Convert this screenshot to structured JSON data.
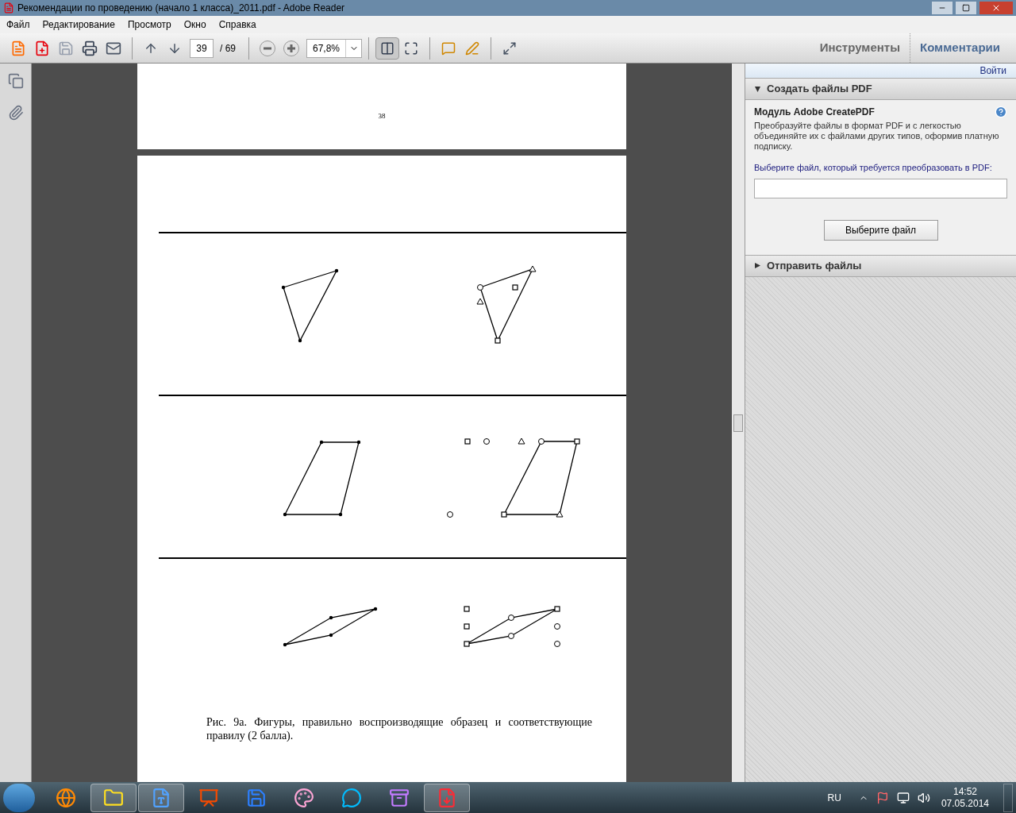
{
  "window": {
    "title": "Рекомендации по проведению (начало 1 класса)_2011.pdf - Adobe Reader"
  },
  "menu": [
    "Файл",
    "Редактирование",
    "Просмотр",
    "Окно",
    "Справка"
  ],
  "toolbar": {
    "page": "39",
    "total": "/ 69",
    "zoom": "67,8%"
  },
  "right_tabs": [
    {
      "label": "Инструменты",
      "selected": false
    },
    {
      "label": "Комментарии",
      "selected": true
    }
  ],
  "document": {
    "page_number": "38",
    "caption": "Рис. 9а. Фигуры, правильно воспроизводящие образец и соответствующие правилу (2 балла)."
  },
  "panel": {
    "login": "Войти",
    "sections": [
      {
        "title": "Создать файлы PDF",
        "expanded": true,
        "heading": "Модуль Adobe CreatePDF",
        "text": "Преобразуйте файлы в формат PDF и с легкостью объединяйте их с файлами других типов, оформив платную подписку.",
        "field_label": "Выберите файл, который требуется преобразовать в PDF:",
        "button": "Выберите файл"
      },
      {
        "title": "Отправить файлы",
        "expanded": false
      }
    ]
  },
  "taskbar": {
    "apps": [
      {
        "kind": "browser",
        "open": false
      },
      {
        "kind": "folder",
        "open": true
      },
      {
        "kind": "word",
        "open": true
      },
      {
        "kind": "slides",
        "open": false
      },
      {
        "kind": "disk",
        "open": false
      },
      {
        "kind": "paint",
        "open": false
      },
      {
        "kind": "chat",
        "open": false
      },
      {
        "kind": "archive",
        "open": false
      },
      {
        "kind": "pdf",
        "open": true
      }
    ],
    "language": "RU",
    "time": "14:52",
    "date": "07.05.2014"
  }
}
